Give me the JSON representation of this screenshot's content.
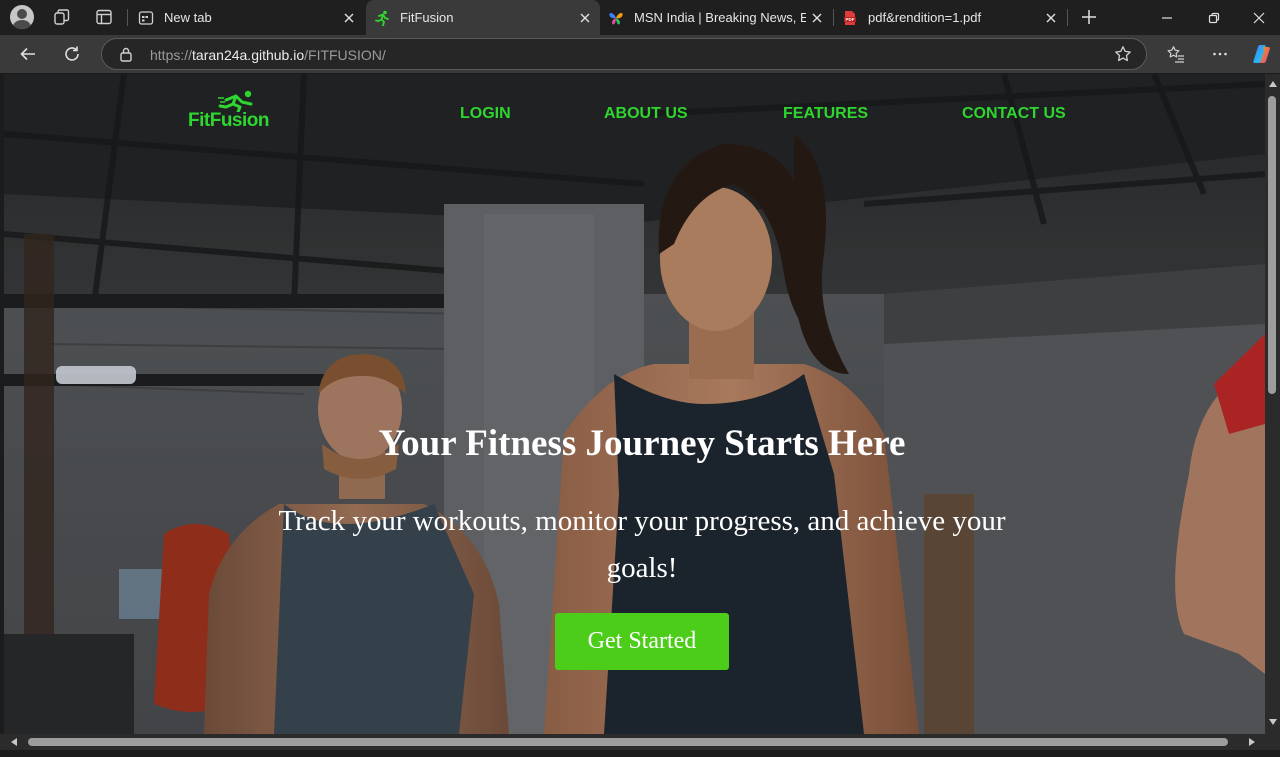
{
  "browser": {
    "tabs": [
      {
        "title": "New tab",
        "icon": "new-tab-page-icon",
        "active": false
      },
      {
        "title": "FitFusion",
        "icon": "runner-favicon-icon",
        "active": true
      },
      {
        "title": "MSN India | Breaking News, Ente",
        "icon": "msn-butterfly-icon",
        "active": false
      },
      {
        "title": "pdf&rendition=1.pdf",
        "icon": "pdf-file-icon",
        "active": false
      }
    ],
    "address_bar": {
      "scheme": "https://",
      "host": "taran24a.github.io",
      "path": "/FITFUSION/"
    },
    "colors": {
      "tab_strip": "#1f1f1f",
      "active_tab": "#3a3a3a",
      "omnibox": "#262626"
    }
  },
  "site": {
    "logo_text": "FitFusion",
    "nav": [
      {
        "label": "LOGIN"
      },
      {
        "label": "ABOUT US"
      },
      {
        "label": "FEATURES"
      },
      {
        "label": "CONTACT US"
      }
    ],
    "hero": {
      "title": "Your Fitness Journey Starts Here",
      "subtitle": "Track your workouts, monitor your progress, and achieve your goals!",
      "cta_label": "Get Started"
    },
    "colors": {
      "brand_green": "#2fd62f",
      "cta_green": "#4ccd1a",
      "hero_text": "#ffffff"
    }
  }
}
